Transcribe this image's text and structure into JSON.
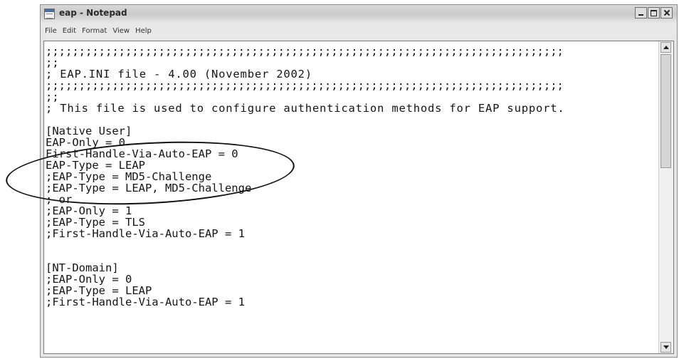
{
  "window": {
    "title": "eap - Notepad",
    "icon": "notepad-icon"
  },
  "menu": {
    "items": [
      "File",
      "Edit",
      "Format",
      "View",
      "Help"
    ]
  },
  "editor": {
    "lines": [
      ";;;;;;;;;;;;;;;;;;;;;;;;;;;;;;;;;;;;;;;;;;;;;;;;;;;;;;;;;;;;;;;;;;;;;;;;;;;;;;",
      ";;",
      "; EAP.INI file - 4.00 (November 2002)",
      ";;;;;;;;;;;;;;;;;;;;;;;;;;;;;;;;;;;;;;;;;;;;;;;;;;;;;;;;;;;;;;;;;;;;;;;;;;;;;;",
      ";;",
      "; This file is used to configure authentication methods for EAP support.",
      "",
      "[Native User]",
      "EAP-Only = 0",
      "First-Handle-Via-Auto-EAP = 0",
      "EAP-Type = LEAP",
      ";EAP-Type = MD5-Challenge",
      ";EAP-Type = LEAP, MD5-Challenge",
      "; or",
      ";EAP-Only = 1",
      ";EAP-Type = TLS",
      ";First-Handle-Via-Auto-EAP = 1",
      "",
      "",
      "[NT-Domain]",
      ";EAP-Only = 0",
      ";EAP-Type = LEAP",
      ";First-Handle-Via-Auto-EAP = 1"
    ]
  },
  "colors": {
    "text": "#151515",
    "editor_background": "#ffffff",
    "annotation": "#111111"
  }
}
